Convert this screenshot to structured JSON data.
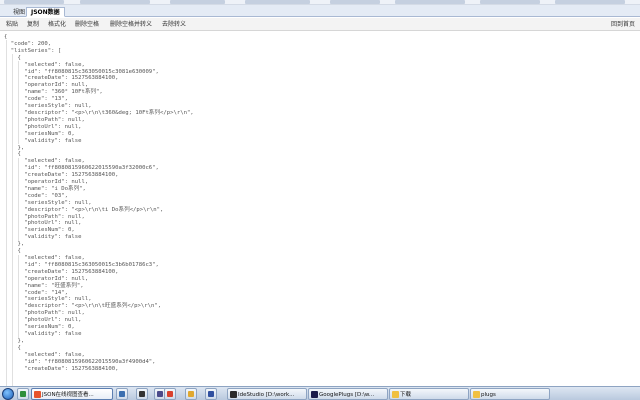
{
  "tabs": {
    "raw": "視图",
    "json": "JSON数据"
  },
  "toolbar": {
    "paste": "粘贴",
    "copy": "复制",
    "format": "格式化",
    "remove_spaces": "删除空格",
    "remove_spaces_escape": "删除空格并转义",
    "unescape": "去除转义",
    "right": "回到首页"
  },
  "json_lines": [
    "{",
    "  \"code\": 200,",
    "  \"listSeries\": [",
    "    {",
    "      \"selected\": false,",
    "      \"id\": \"ff8080815c363050015c3081e630009\",",
    "      \"createDate\": 1527563884100,",
    "      \"operatorId\": null,",
    "      \"name\": \"360° 10Ft系列\",",
    "      \"code\": \"13\",",
    "      \"seriesStyle\": null,",
    "      \"descriptor\": \"<p>\\r\\n\\t360&deg; 10Ft系列</p>\\r\\n\",",
    "      \"photoPath\": null,",
    "      \"photoUrl\": null,",
    "      \"seriesNum\": 0,",
    "      \"validity\": false",
    "    },",
    "    {",
    "      \"selected\": false,",
    "      \"id\": \"ff8080815960622015590a3f32000c6\",",
    "      \"createDate\": 1527563884100,",
    "      \"operatorId\": null,",
    "      \"name\": \"i Do系列\",",
    "      \"code\": \"03\",",
    "      \"seriesStyle\": null,",
    "      \"descriptor\": \"<p>\\r\\n\\ti Do系列</p>\\r\\n\",",
    "      \"photoPath\": null,",
    "      \"photoUrl\": null,",
    "      \"seriesNum\": 0,",
    "      \"validity\": false",
    "    },",
    "    {",
    "      \"selected\": false,",
    "      \"id\": \"ff8080815c363050015c3b6b01786c3\",",
    "      \"createDate\": 1527563884100,",
    "      \"operatorId\": null,",
    "      \"name\": \"旺盛系列\",",
    "      \"code\": \"14\",",
    "      \"seriesStyle\": null,",
    "      \"descriptor\": \"<p>\\r\\n\\t旺盛系列</p>\\r\\n\",",
    "      \"photoPath\": null,",
    "      \"photoUrl\": null,",
    "      \"seriesNum\": 0,",
    "      \"validity\": false",
    "    },",
    "    {",
    "      \"selected\": false,",
    "      \"id\": \"ff8080815960622015590a3f4900d4\",",
    "      \"createDate\": 1527563884100,"
  ],
  "taskbar": {
    "items": [
      {
        "label": "JSON在线视图查看...",
        "icon_color": "#e7542c"
      },
      {
        "label": "IdeStudio [D:\\work...",
        "icon_color": "#2a2a2a"
      },
      {
        "label": "GooglePlugs [D:\\w...",
        "icon_color": "#1a1a4a"
      },
      {
        "label": "下载",
        "icon_color": "#f0c040"
      },
      {
        "label": "plugs",
        "icon_color": "#f0c040"
      }
    ],
    "pins": [
      {
        "name": "chrome-pin-icon",
        "color": "#2f8f3c"
      },
      {
        "name": "help-pin-icon",
        "color": "#3b6fb0"
      },
      {
        "name": "terminal-pin-icon",
        "color": "#333333"
      },
      {
        "name": "media-pin-icon",
        "color": "#4a4a8a"
      },
      {
        "name": "browser-pin-icon",
        "color": "#d9412e"
      },
      {
        "name": "folder-pin-icon",
        "color": "#e0a830"
      },
      {
        "name": "ide-pin-icon",
        "color": "#3050a0"
      }
    ]
  },
  "colors": {
    "accent": "#a9b9d3",
    "taskbar": "#b9c9de"
  }
}
